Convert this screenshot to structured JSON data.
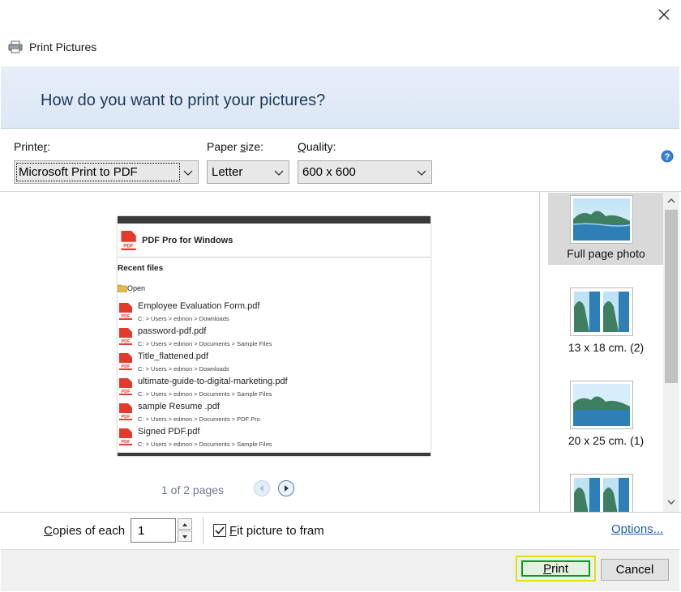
{
  "window": {
    "title": "Print Pictures",
    "close_icon": "close-icon"
  },
  "banner": {
    "heading": "How do you want to print your pictures?"
  },
  "options": {
    "printer": {
      "label_pre": "Printe",
      "label_key": "r",
      "label_post": ":",
      "value": "Microsoft Print to PDF"
    },
    "paper_size": {
      "label_pre": "Paper ",
      "label_key": "s",
      "label_post": "ize:",
      "value": "Letter"
    },
    "quality": {
      "label_pre": "",
      "label_key": "Q",
      "label_post": "uality:",
      "value": "600 x 600"
    },
    "help_icon": "help-icon"
  },
  "preview": {
    "app_title": "PDF Pro for Windows",
    "recent_heading": "Recent files",
    "open_label": "Open",
    "files": [
      {
        "name": "Employee Evaluation Form.pdf",
        "path": "C: > Users > edmon > Downloads"
      },
      {
        "name": "password-pdf.pdf",
        "path": "C: > Users > edmon > Documents > Sample Files"
      },
      {
        "name": "Title_flattened.pdf",
        "path": "C: > Users > edmon > Downloads"
      },
      {
        "name": "ultimate-guide-to-digital-marketing.pdf",
        "path": "C: > Users > edmon > Documents > Sample Files"
      },
      {
        "name": "sample Resume .pdf",
        "path": "C: > Users > edmon > Documents > PDF Pro"
      },
      {
        "name": "Signed PDF.pdf",
        "path": "C: > Users > edmon > Documents > Sample Files"
      }
    ],
    "page_count": "1 of 2 pages"
  },
  "layouts": [
    {
      "label": "Full page photo",
      "selected": true
    },
    {
      "label": "13 x 18 cm. (2)",
      "selected": false
    },
    {
      "label": "20 x 25 cm. (1)",
      "selected": false
    },
    {
      "label": "",
      "selected": false
    }
  ],
  "bottom": {
    "copies_pre": "",
    "copies_key": "C",
    "copies_post": "opies of each",
    "copies_value": "1",
    "fit_pre": "",
    "fit_key": "F",
    "fit_post": "it picture to fram",
    "fit_checked": true,
    "options_link": "Options..."
  },
  "buttons": {
    "print_key": "P",
    "print_rest": "rint",
    "cancel": "Cancel"
  },
  "colors": {
    "banner_text": "#1e395b",
    "link": "#1a5fb4",
    "print_focus_outer": "#e8df00",
    "print_focus_inner": "#0a9c16",
    "pdf_red": "#e23b2e"
  }
}
